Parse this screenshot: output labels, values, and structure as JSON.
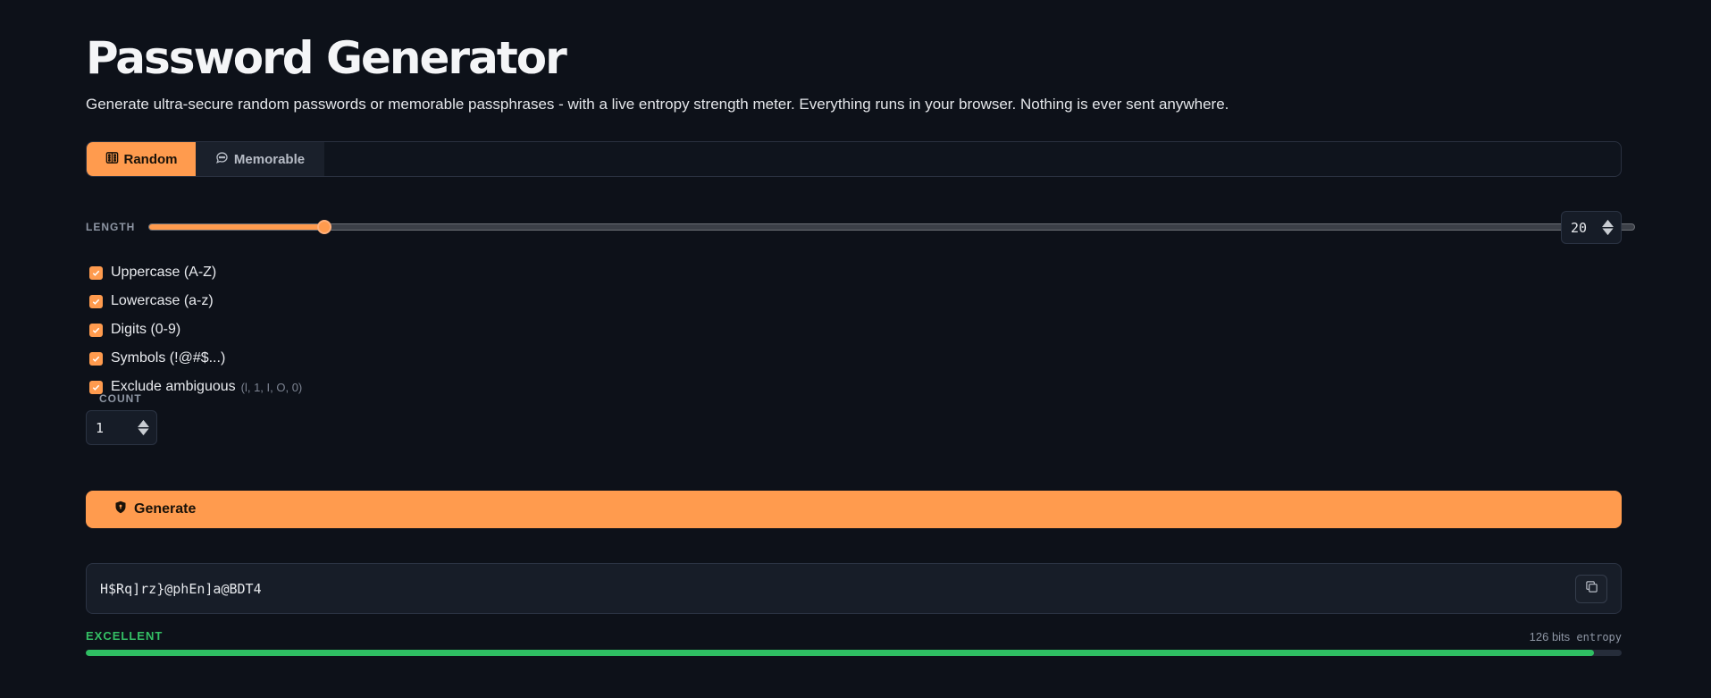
{
  "page": {
    "title": "Password Generator",
    "subtitle": "Generate ultra-secure random passwords or memorable passphrases - with a live entropy strength meter. Everything runs in your browser. Nothing is ever sent anywhere."
  },
  "tabs": [
    {
      "label": "Random",
      "icon": "dice-icon",
      "active": true
    },
    {
      "label": "Memorable",
      "icon": "chat-icon",
      "active": false
    }
  ],
  "length": {
    "label": "LENGTH",
    "value": "20",
    "slider_fraction": 0.118
  },
  "options": [
    {
      "label": "Uppercase (A-Z)",
      "checked": true,
      "hint": ""
    },
    {
      "label": "Lowercase (a-z)",
      "checked": true,
      "hint": ""
    },
    {
      "label": "Digits (0-9)",
      "checked": true,
      "hint": ""
    },
    {
      "label": "Symbols (!@#$...)",
      "checked": true,
      "hint": ""
    },
    {
      "label": "Exclude ambiguous",
      "checked": true,
      "hint": "(l, 1, I, O, 0)"
    }
  ],
  "count": {
    "label": "COUNT",
    "value": "1"
  },
  "generate": {
    "label": "Generate",
    "icon": "shield-icon"
  },
  "output": {
    "password": "H$Rq]rz}@phEn]a@BDT4",
    "copy_icon": "copy-icon"
  },
  "strength": {
    "label": "EXCELLENT",
    "bits": "126 bits",
    "suffix": "entropy",
    "meter_fraction": 0.982
  },
  "colors": {
    "accent": "#ff9b4e",
    "background": "#0d1119",
    "strength_good": "#2fbf63"
  }
}
